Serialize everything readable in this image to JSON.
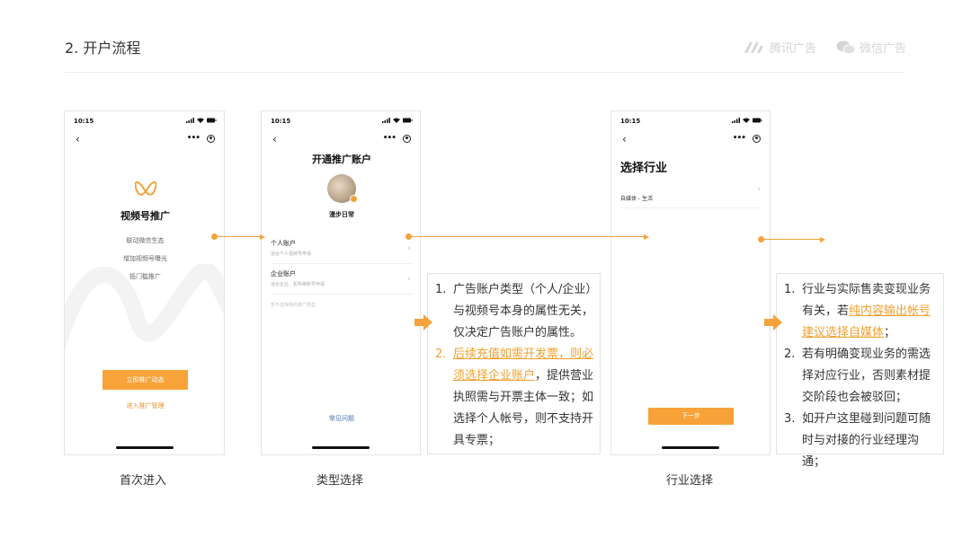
{
  "page": {
    "title": "2. 开户流程"
  },
  "brands": {
    "tencent_ads": "腾讯广告",
    "wechat_ads": "微信广告"
  },
  "phone1": {
    "time": "10:15",
    "heading": "视频号推广",
    "lines": [
      "联动微信生态",
      "增加视频号曝光",
      "抵门槛推广"
    ],
    "primary_button": "立即推广动态",
    "secondary_link": "进入推广管理",
    "caption": "首次进入"
  },
  "phone2": {
    "time": "10:15",
    "heading": "开通推广账户",
    "account_name": "漫步日常",
    "options": [
      {
        "title": "个人账户",
        "desc": "适合个人视频号申请"
      },
      {
        "title": "企业账户",
        "desc": "适合企业、机构等账号申请"
      }
    ],
    "hint": "暂不选择我的推广类型",
    "faq": "常见问题",
    "caption": "类型选择"
  },
  "phone3": {
    "time": "10:15",
    "heading": "选择行业",
    "industry": "自媒体 - 生活",
    "next_button": "下一步",
    "caption": "行业选择"
  },
  "note1": {
    "items": [
      {
        "num": "1.",
        "text": "广告账户类型（个人/企业）与视频号本身的属性无关，仅决定广告账户的属性。"
      },
      {
        "num": "2.",
        "highlight": "后续充值如需开发票，则必须选择企业账户",
        "text": "，提供营业执照需与开票主体一致；如选择个人帐号，则不支持开具专票；"
      }
    ]
  },
  "note2": {
    "items": [
      {
        "num": "1.",
        "pre": "行业与实际售卖变现业务有关，若",
        "highlight": "纯内容输出帐号建议选择自媒体",
        "post": "；"
      },
      {
        "num": "2.",
        "text": "若有明确变现业务的需选择对应行业，否则素材提交阶段也会被驳回；"
      },
      {
        "num": "3.",
        "text": "如开户这里碰到问题可随时与对接的行业经理沟通；"
      }
    ]
  },
  "colors": {
    "accent": "#f5a23b",
    "button": "#f7a33a",
    "text": "#333333"
  }
}
